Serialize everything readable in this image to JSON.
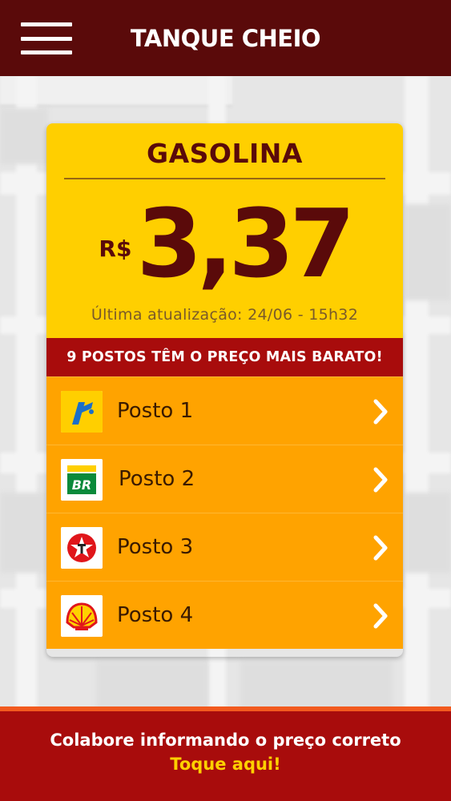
{
  "header": {
    "title": "TANQUE CHEIO",
    "menu_icon": "hamburger-menu-icon"
  },
  "fuel": {
    "name": "GASOLINA",
    "currency": "R$",
    "price": "3,37",
    "last_update": "Última atualização: 24/06 - 15h32"
  },
  "banner": {
    "text": "9 POSTOS TÊM O PREÇO MAIS BARATO!"
  },
  "stations": [
    {
      "name": "Posto 1",
      "logo": "ipiranga-logo-icon"
    },
    {
      "name": "Posto 2",
      "logo": "br-petrobras-logo-icon"
    },
    {
      "name": "Posto 3",
      "logo": "texaco-logo-icon"
    },
    {
      "name": "Posto 4",
      "logo": "shell-logo-icon"
    }
  ],
  "footer": {
    "text": "Colabore informando o preço correto",
    "cta": "Toque aqui!"
  },
  "colors": {
    "header_bg": "#5a0a0a",
    "price_panel": "#ffcf00",
    "banner_bg": "#a80c0c",
    "station_bg": "#ffa300",
    "footer_cta": "#ffd000"
  }
}
